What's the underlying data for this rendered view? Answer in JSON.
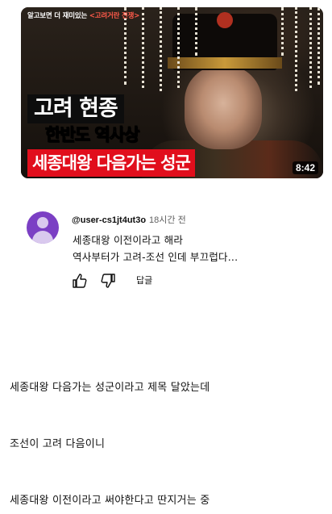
{
  "video": {
    "top_caption_prefix": "알고보면 더 재미있는",
    "top_caption_highlight": "<고려거란 전쟁>",
    "title_line1": "고려 현종",
    "title_line2": "한반도 역사상",
    "title_line3": "세종대왕 다음가는 성군",
    "duration": "8:42"
  },
  "comment": {
    "author": "@user-cs1jt4ut3o",
    "time": "18시간 전",
    "text_line1": "세종대왕 이전이라고 해라",
    "text_line2": "역사부터가 고려-조선 인데 부끄럽다...",
    "reply_label": "답글",
    "avatar_color": "#7b3fc4"
  },
  "post": {
    "line1": "세종대왕 다음가는 성군이라고 제목 달았는데",
    "line2": "조선이 고려 다음이니",
    "line3": "세종대왕 이전이라고 써야한다고 딴지거는 중"
  }
}
